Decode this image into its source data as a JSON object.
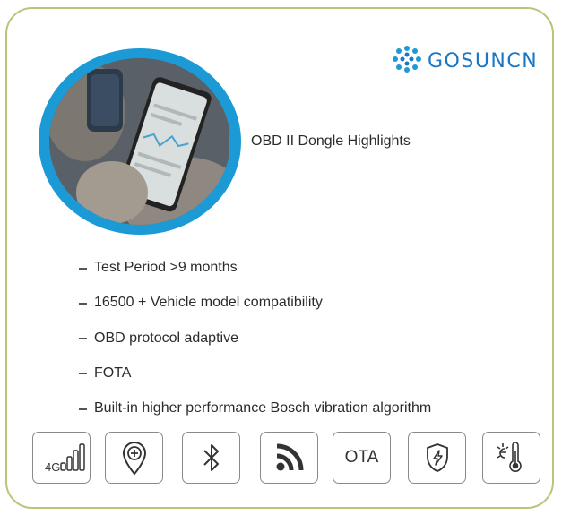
{
  "brand": {
    "name": "GOSUNCN",
    "logo_icon": "gosuncn-logo-icon",
    "color": "#1878c6"
  },
  "headline": "OBD II Dongle Highlights",
  "photo": {
    "description_icon": "phone-dongle-photo"
  },
  "features": [
    "Test Period >9 months",
    "16500 + Vehicle model compatibility",
    "OBD protocol adaptive",
    "FOTA",
    "Built-in higher performance Bosch vibration algorithm"
  ],
  "icons": {
    "signal_4g_label": "4G",
    "ota_label": "OTA",
    "names": [
      "4g-signal-icon",
      "location-pin-icon",
      "bluetooth-icon",
      "wifi-icon",
      "ota-icon",
      "shield-lightning-icon",
      "temperature-icon"
    ]
  },
  "colors": {
    "accent": "#1c9ad6",
    "border": "#b5c77a"
  }
}
